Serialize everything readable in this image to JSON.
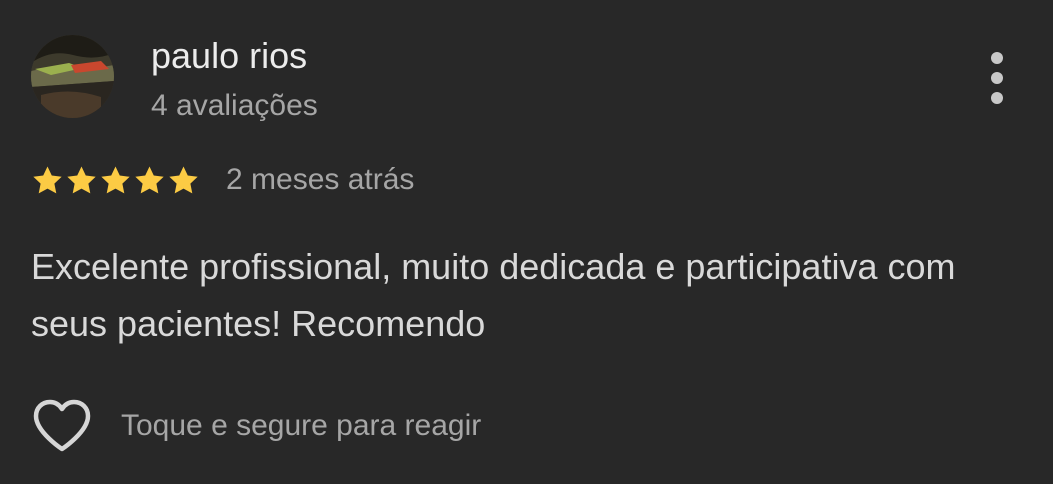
{
  "review": {
    "author": {
      "name": "paulo rios",
      "reviews_count": "4 avaliações",
      "avatar": "profile-photo-landscape"
    },
    "rating": {
      "stars": 5,
      "max": 5,
      "star_color": "#FCCB44"
    },
    "date": "2 meses atrás",
    "text": "Excelente profissional, muito dedicada e participativa com seus pacientes! Recomendo",
    "reaction": {
      "icon": "heart-outline-icon",
      "hint": "Toque e segure para reagir"
    },
    "menu_icon": "more-vertical-icon"
  },
  "theme": {
    "background": "#282828",
    "primary_text": "#ececec",
    "secondary_text": "#a6a6a6"
  }
}
